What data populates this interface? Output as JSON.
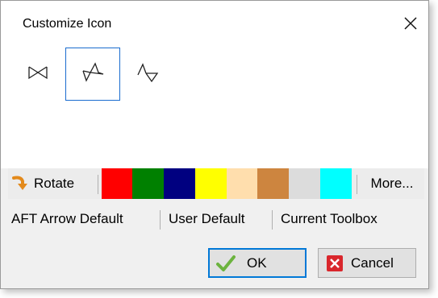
{
  "dialog": {
    "title": "Customize Icon"
  },
  "icons": {
    "close": "close-icon",
    "shapes": [
      "bowtie-arrow-icon",
      "double-arrow-icon",
      "triangle-arrow-icon"
    ],
    "selected_shape": 1
  },
  "toolbar": {
    "rotate_label": "Rotate",
    "more_label": "More...",
    "swatches": [
      "#ff0000",
      "#008000",
      "#000080",
      "#ffff00",
      "#ffdead",
      "#cd853f",
      "#dcdcdc",
      "#00ffff"
    ]
  },
  "presets": {
    "aft_label": "AFT Arrow Default",
    "user_label": "User Default",
    "toolbox_label": "Current Toolbox"
  },
  "buttons": {
    "ok_label": "OK",
    "cancel_label": "Cancel"
  }
}
